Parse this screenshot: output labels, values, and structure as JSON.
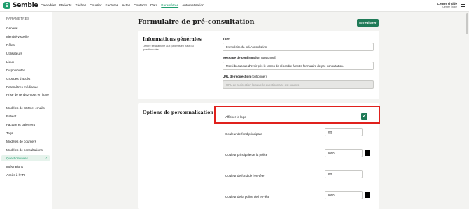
{
  "brand": {
    "name": "Semble"
  },
  "nav": [
    "Calendrier",
    "Patients",
    "Tâches",
    "Courrier",
    "Factures",
    "Actes",
    "Contacts",
    "Data",
    "Paramètres",
    "Automatisation"
  ],
  "nav_active": "Paramètres",
  "help": {
    "title": "Centre d'aide",
    "subtitle": "Centre Étoile"
  },
  "sidebar": {
    "heading": "PARAMÈTRES",
    "items": [
      "Général",
      "Identité visuelle",
      "Rôles",
      "Utilisateurs",
      "Lieux",
      "Disponibilités",
      "Groupes d'accès",
      "Paramètres médicaux",
      "Prise de rendez-vous en ligne",
      "Modèles de SMS et emails",
      "Patient",
      "Facture et paiement",
      "Tags",
      "Modèles de courriers",
      "Modèles de consultations",
      "Questionnaires",
      "Intégrations",
      "Accès à l'API"
    ],
    "active": "Questionnaires",
    "active_chevron": "›"
  },
  "page": {
    "title": "Formulaire de pré-consultation",
    "save_label": "Enregistrer"
  },
  "general": {
    "title": "Informations générales",
    "description": "Le titre sera affiché aux patients en haut du questionnaire",
    "title_label": "Titre",
    "title_value": "Formulaire de pré-consultation",
    "confirm_label": "Message de confirmation",
    "confirm_optional": "(optionnel)",
    "confirm_value": "Merci beaucoup d'avoir pris le temps de répondre à notre formulaire de pré-consultation.",
    "redirect_label": "URL de redirection",
    "redirect_optional": "(optionnel)",
    "redirect_placeholder": "URL de redirection lorsque le questionnaire est soumis"
  },
  "custom": {
    "title": "Options de personnalisation",
    "show_logo_label": "Afficher le logo",
    "show_logo_checked": true,
    "check_glyph": "✓",
    "colors": [
      {
        "label": "Couleur de fond principale",
        "value": "#fff",
        "swatch": "#ffffff"
      },
      {
        "label": "Couleur principale de la police",
        "value": "#000",
        "swatch": "#000000"
      },
      {
        "label": "Couleur de fond de l'en-tête",
        "value": "#fff",
        "swatch": "#ffffff"
      },
      {
        "label": "Couleur de la police de l'en-tête",
        "value": "#000",
        "swatch": "#000000"
      }
    ]
  },
  "colors": {
    "accent": "#1f9e6e",
    "button": "#1f7a57",
    "highlight": "#e0211d"
  }
}
